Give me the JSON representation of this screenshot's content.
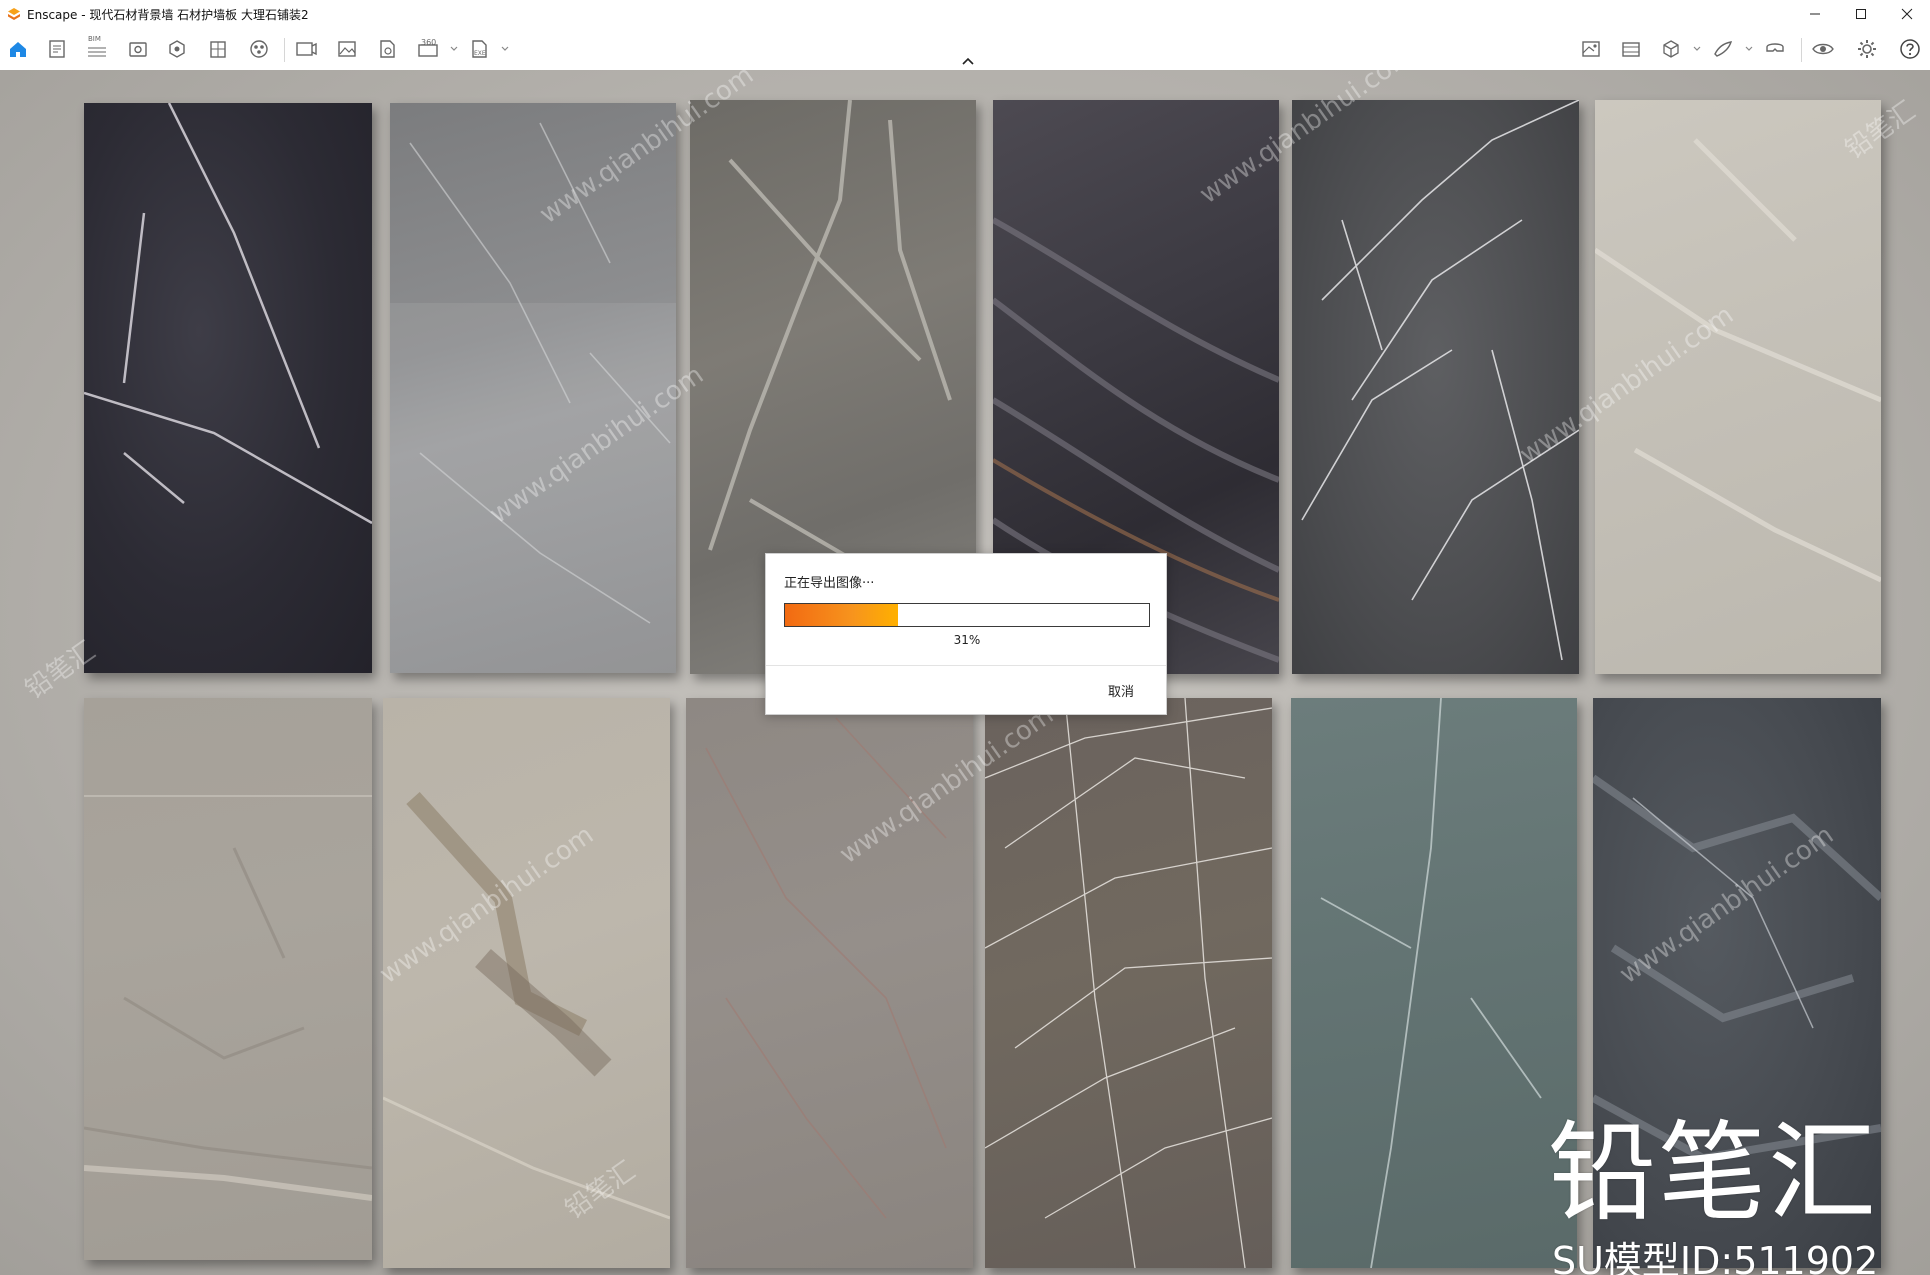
{
  "window": {
    "app_name": "Enscape",
    "title": "Enscape - 现代石材背景墙 石材护墙板 大理石铺装2",
    "minimize_icon": "minimize-icon",
    "maximize_icon": "maximize-icon",
    "close_icon": "close-icon"
  },
  "toolbar": {
    "left_icons": [
      "home-icon",
      "notes-icon",
      "bim-icon",
      "view-icon",
      "asset-library-icon",
      "material-editor-icon",
      "atmosphere-icon",
      "batch-render-icon",
      "screenshot-icon",
      "export-image-icon",
      "panorama-360-icon",
      "export-exe-icon"
    ],
    "right_icons": [
      "visual-settings-icon",
      "video-editor-icon",
      "cube-view-icon",
      "sketch-mode-icon",
      "vr-headset-icon",
      "eye-icon",
      "settings-icon",
      "help-icon"
    ],
    "bim_label": "BIM",
    "exe_label": "EXE",
    "pano_label": "360"
  },
  "viewport": {
    "content": "marble-tiles-render",
    "tile_names": [
      "marble-tile-1",
      "marble-tile-2",
      "marble-tile-3",
      "marble-tile-4",
      "marble-tile-5",
      "marble-tile-6",
      "marble-tile-7",
      "marble-tile-8",
      "marble-tile-9",
      "marble-tile-10",
      "marble-tile-11",
      "marble-tile-12"
    ]
  },
  "export_dialog": {
    "title": "正在导出图像···",
    "progress_percent": 31,
    "progress_text": "31%",
    "cancel_label": "取消",
    "accent_color": "#f26a12"
  },
  "watermark": {
    "brand": "铅笔汇",
    "model_id": "SU模型ID:511902",
    "site": "www.qianbihui.com"
  }
}
